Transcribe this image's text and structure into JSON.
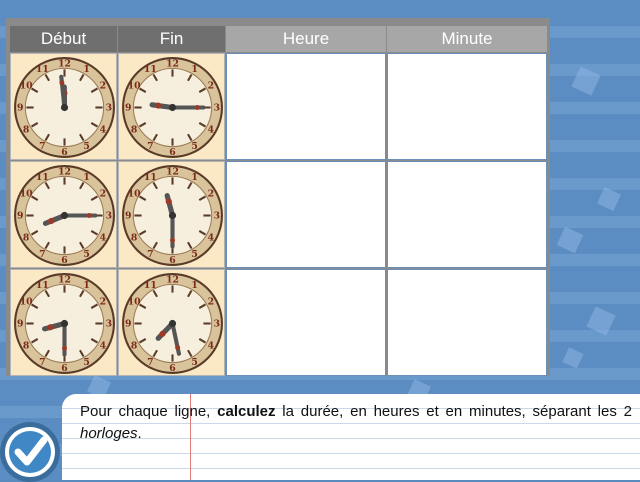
{
  "table": {
    "headers": {
      "start": "Début",
      "end": "Fin",
      "hours": "Heure",
      "minutes": "Minute"
    },
    "rows": [
      {
        "start_clock": {
          "hour": 11,
          "minute": 59
        },
        "end_clock": {
          "hour": 9,
          "minute": 15
        },
        "hours_answer": "",
        "minutes_answer": ""
      },
      {
        "start_clock": {
          "hour": 8,
          "minute": 15
        },
        "end_clock": {
          "hour": 11,
          "minute": 30
        },
        "hours_answer": "",
        "minutes_answer": ""
      },
      {
        "start_clock": {
          "hour": 8,
          "minute": 30
        },
        "end_clock": {
          "hour": 7,
          "minute": 28
        },
        "hours_answer": "",
        "minutes_answer": ""
      }
    ]
  },
  "instruction": {
    "part1": "Pour chaque ligne, ",
    "bold": "calculez",
    "part2": " la durée, en heures et en minutes, séparant les 2 ",
    "italic": "horloges",
    "part3": "."
  },
  "validate_button": {
    "icon": "checkmark-icon"
  },
  "colors": {
    "background": "#5c8dc2",
    "header_dark": "#6f6f6f",
    "header_light": "#a7a7a7",
    "clock_cell": "#fbe9c6",
    "hand": "#555555",
    "hand_tip": "#9c3a2a"
  }
}
